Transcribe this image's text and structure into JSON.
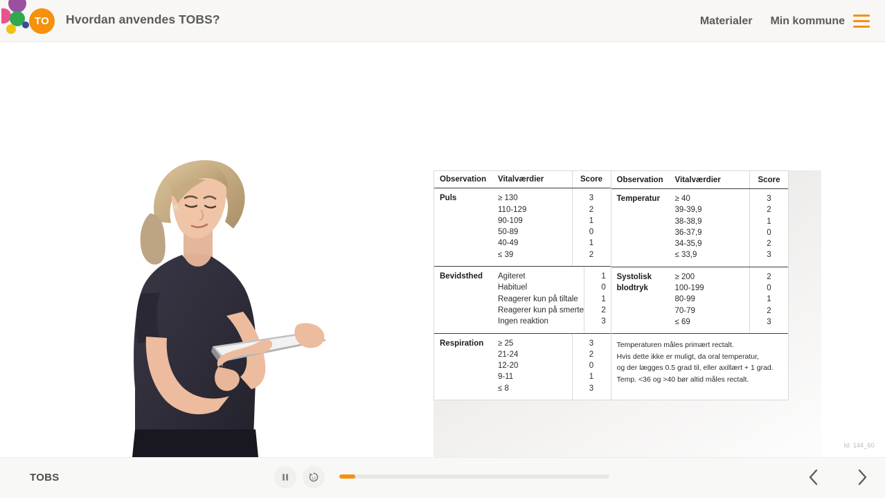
{
  "header": {
    "logo_icon": "dots-logo",
    "avatar_initials": "TO",
    "title": "Hvordan anvendes TOBS?",
    "nav": [
      {
        "label": "Materialer",
        "name": "nav-materialer"
      },
      {
        "label": "Min kommune",
        "name": "nav-min-kommune"
      }
    ],
    "menu_icon": "hamburger-icon",
    "accent_color": "#f5910c",
    "text_color": "#5a5a5a",
    "background_color": "#f8f7f5"
  },
  "slide": {
    "photo_alt": "nurse-with-tablet-photo",
    "id_label": "Id: 144_60",
    "table": {
      "left": {
        "headers": [
          "Observation",
          "Vitalværdier",
          "Score"
        ],
        "groups": [
          {
            "observation": "Puls",
            "rows": [
              {
                "value": "≥ 130",
                "score": "3"
              },
              {
                "value": "110-129",
                "score": "2"
              },
              {
                "value": "90-109",
                "score": "1"
              },
              {
                "value": "50-89",
                "score": "0"
              },
              {
                "value": "40-49",
                "score": "1"
              },
              {
                "value": "≤ 39",
                "score": "2"
              }
            ]
          },
          {
            "observation": "Bevidsthed",
            "rows": [
              {
                "value": "Agiteret",
                "score": "1"
              },
              {
                "value": "Habituel",
                "score": "0"
              },
              {
                "value": "Reagerer kun på tiltale",
                "score": "1"
              },
              {
                "value": "Reagerer kun på smerte",
                "score": "2"
              },
              {
                "value": "Ingen reaktion",
                "score": "3"
              }
            ]
          },
          {
            "observation": "Respiration",
            "rows": [
              {
                "value": "≥ 25",
                "score": "3"
              },
              {
                "value": "21-24",
                "score": "2"
              },
              {
                "value": "12-20",
                "score": "0"
              },
              {
                "value": "9-11",
                "score": "1"
              },
              {
                "value": "≤ 8",
                "score": "3"
              }
            ]
          }
        ]
      },
      "right": {
        "headers": [
          "Observation",
          "Vitalværdier",
          "Score"
        ],
        "groups": [
          {
            "observation": "Temperatur",
            "rows": [
              {
                "value": "≥ 40",
                "score": "3"
              },
              {
                "value": "39-39,9",
                "score": "2"
              },
              {
                "value": "38-38,9",
                "score": "1"
              },
              {
                "value": "36-37,9",
                "score": "0"
              },
              {
                "value": "34-35,9",
                "score": "2"
              },
              {
                "value": "≤ 33,9",
                "score": "3"
              }
            ]
          },
          {
            "observation": "Systolisk blodtryk",
            "rows": [
              {
                "value": "≥ 200",
                "score": "2"
              },
              {
                "value": "100-199",
                "score": "0"
              },
              {
                "value": "80-99",
                "score": "1"
              },
              {
                "value": "70-79",
                "score": "2"
              },
              {
                "value": "≤ 69",
                "score": "3"
              }
            ]
          }
        ],
        "note": [
          "Temperaturen måles primært rectalt.",
          "Hvis dette ikke er muligt, da oral temperatur,",
          "og der lægges 0.5 grad til, eller axillært + 1 grad.",
          "Temp. <36 og >40 bør altid måles rectalt."
        ]
      }
    }
  },
  "player": {
    "title": "TOBS",
    "pause_icon": "pause-icon",
    "replay_icon": "replay-10-icon",
    "progress_percent": 6,
    "prev_icon": "chevron-left-icon",
    "next_icon": "chevron-right-icon",
    "progress_color": "#f5910c"
  }
}
